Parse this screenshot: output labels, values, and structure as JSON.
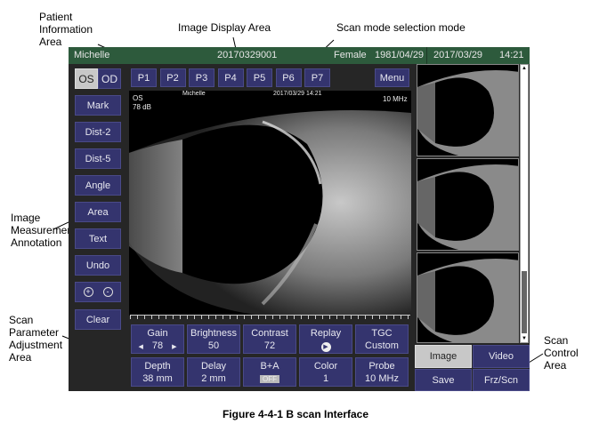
{
  "annotations": {
    "patient_info": "Patient Information Area",
    "image_display": "Image Display Area",
    "scan_mode": "Scan mode selection mode",
    "measurement": "Image Measurement Annotation",
    "scan_param": "Scan Parameter Adjustment Area",
    "scan_control": "Scan Control Area"
  },
  "header": {
    "name": "Michelle",
    "id": "20170329001",
    "sex": "Female",
    "dob": "1981/04/29",
    "date": "2017/03/29",
    "time": "14:21"
  },
  "eye": {
    "os": "OS",
    "od": "OD"
  },
  "tools": [
    "Mark",
    "Dist-2",
    "Dist-5",
    "Angle",
    "Area",
    "Text",
    "Undo"
  ],
  "zoom": {
    "plus": "+",
    "minus": "-"
  },
  "clear": "Clear",
  "presets": [
    "P1",
    "P2",
    "P3",
    "P4",
    "P5",
    "P6",
    "P7"
  ],
  "menu": "Menu",
  "overlay": {
    "eye": "OS",
    "gain": "78 dB",
    "name": "Michelle",
    "datetime": "2017/03/29 14:21",
    "freq": "10 MHz"
  },
  "params": [
    {
      "label": "Gain",
      "value": "78"
    },
    {
      "label": "Brightness",
      "value": "50"
    },
    {
      "label": "Contrast",
      "value": "72"
    },
    {
      "label": "Replay",
      "value": "▶"
    },
    {
      "label": "TGC",
      "value": "Custom"
    },
    {
      "label": "Depth",
      "value": "38 mm"
    },
    {
      "label": "Delay",
      "value": "2 mm"
    },
    {
      "label": "B+A",
      "value": "OFF"
    },
    {
      "label": "Color",
      "value": "1"
    },
    {
      "label": "Probe",
      "value": "10 MHz"
    }
  ],
  "controls": {
    "image": "Image",
    "video": "Video",
    "save": "Save",
    "freeze": "Frz/Scn"
  },
  "caption": "Figure 4-4-1 B scan Interface"
}
